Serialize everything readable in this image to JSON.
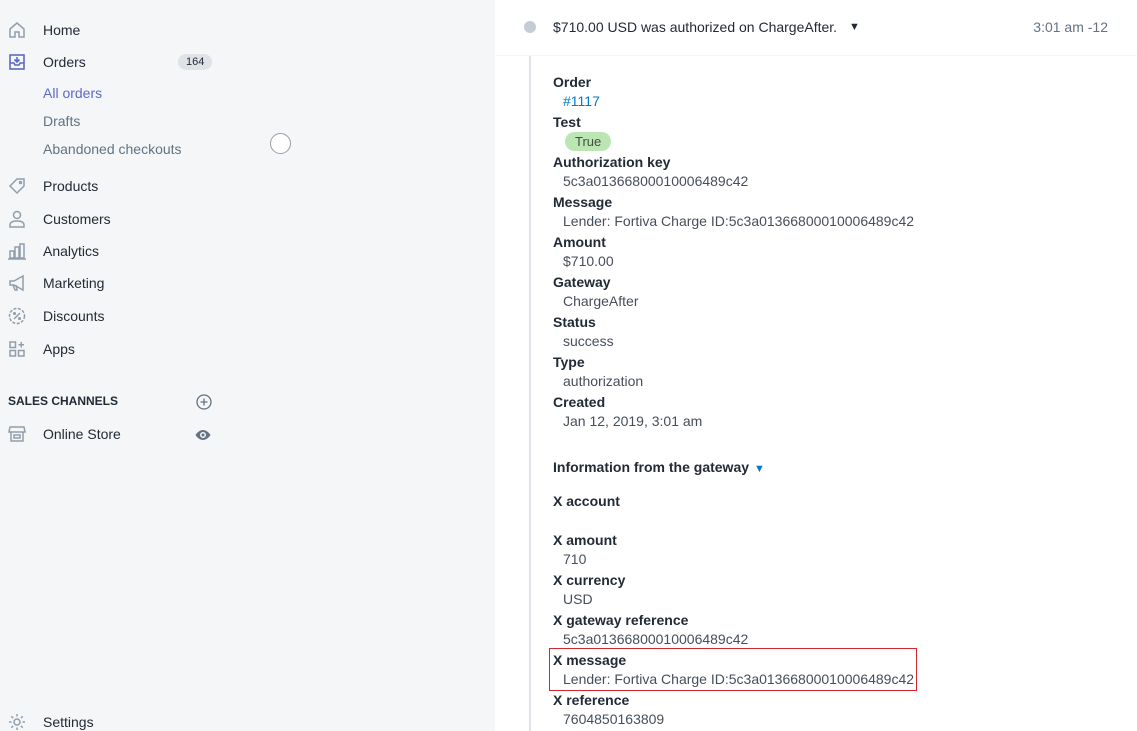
{
  "sidebar": {
    "home": "Home",
    "orders": "Orders",
    "orders_count": "164",
    "all_orders": "All orders",
    "drafts": "Drafts",
    "abandoned_checkouts": "Abandoned checkouts",
    "products": "Products",
    "customers": "Customers",
    "analytics": "Analytics",
    "marketing": "Marketing",
    "discounts": "Discounts",
    "apps": "Apps",
    "sales_channels": "SALES CHANNELS",
    "online_store": "Online Store",
    "settings": "Settings"
  },
  "event": {
    "text": "$710.00 USD was authorized on ChargeAfter.",
    "time": "3:01 am -12"
  },
  "details": {
    "order_label": "Order",
    "order_value": "#1117",
    "test_label": "Test",
    "test_value": "True",
    "auth_key_label": "Authorization key",
    "auth_key_value": "5c3a01366800010006489c42",
    "message_label": "Message",
    "message_value": "Lender: Fortiva Charge ID:5c3a01366800010006489c42",
    "amount_label": "Amount",
    "amount_value": "$710.00",
    "gateway_label": "Gateway",
    "gateway_value": "ChargeAfter",
    "status_label": "Status",
    "status_value": "success",
    "type_label": "Type",
    "type_value": "authorization",
    "created_label": "Created",
    "created_value": "Jan 12, 2019, 3:01 am"
  },
  "gateway": {
    "header": "Information from the gateway",
    "x_account_label": "X account",
    "x_amount_label": "X amount",
    "x_amount_value": "710",
    "x_currency_label": "X currency",
    "x_currency_value": "USD",
    "x_gateway_ref_label": "X gateway reference",
    "x_gateway_ref_value": "5c3a01366800010006489c42",
    "x_message_label": "X message",
    "x_message_value": "Lender: Fortiva Charge ID:5c3a01366800010006489c42",
    "x_reference_label": "X reference",
    "x_reference_value": "7604850163809"
  },
  "colors": {
    "accent": "#5c6ac4",
    "link": "#007ace",
    "success_pill": "#bbe5b3",
    "highlight": "#d0282e"
  },
  "icons": [
    "home-icon",
    "orders-icon",
    "products-tag-icon",
    "customers-icon",
    "analytics-icon",
    "marketing-megaphone-icon",
    "discounts-icon",
    "apps-icon",
    "add-channel-icon",
    "online-store-icon",
    "view-eye-icon",
    "settings-gear-icon"
  ]
}
